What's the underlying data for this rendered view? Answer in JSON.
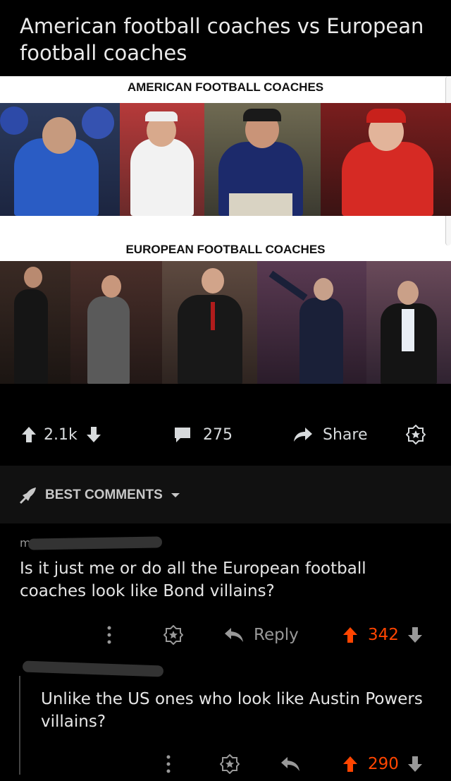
{
  "post": {
    "title": "American football coaches vs European football coaches",
    "image": {
      "caption_top": "AMERICAN FOOTBALL COACHES",
      "caption_bottom": "EUROPEAN FOOTBALL COACHES"
    },
    "actions": {
      "upvotes": "2.1k",
      "comments": "275",
      "share_label": "Share"
    }
  },
  "sort": {
    "label": "BEST COMMENTS"
  },
  "comments": [
    {
      "username_visible": "m",
      "body": "Is it just me or do all the European football coaches look like Bond villains?",
      "reply_label": "Reply",
      "score": "342"
    },
    {
      "body": "Unlike the US ones who look like Austin Powers villains?",
      "score": "290"
    }
  ],
  "colors": {
    "background": "#000000",
    "upvoted": "#ff4500",
    "muted": "#d7dadc"
  }
}
